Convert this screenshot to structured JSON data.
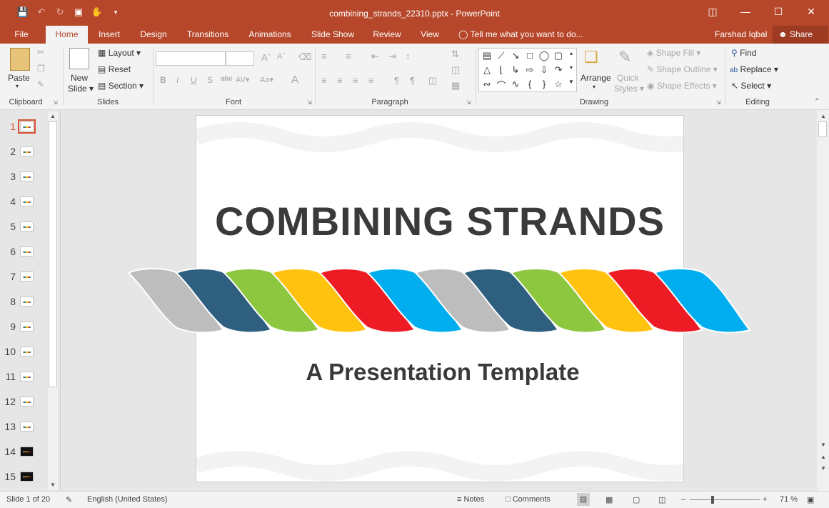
{
  "window": {
    "title": "combining_strands_22310.pptx - PowerPoint"
  },
  "tabs": [
    "File",
    "Home",
    "Insert",
    "Design",
    "Transitions",
    "Animations",
    "Slide Show",
    "Review",
    "View"
  ],
  "active_tab": "Home",
  "tell_me": "Tell me what you want to do...",
  "user_name": "Farshad Iqbal",
  "share_label": "Share",
  "ribbon": {
    "clipboard": {
      "label": "Clipboard",
      "paste": "Paste"
    },
    "slides": {
      "label": "Slides",
      "new_slide_1": "New",
      "new_slide_2": "Slide",
      "layout": "Layout",
      "reset": "Reset",
      "section": "Section"
    },
    "font": {
      "label": "Font"
    },
    "paragraph": {
      "label": "Paragraph"
    },
    "drawing": {
      "label": "Drawing",
      "arrange": "Arrange",
      "quick_styles_1": "Quick",
      "quick_styles_2": "Styles",
      "shape_fill": "Shape Fill",
      "shape_outline": "Shape Outline",
      "shape_effects": "Shape Effects"
    },
    "editing": {
      "label": "Editing",
      "find": "Find",
      "replace": "Replace",
      "select": "Select"
    }
  },
  "slide_numbers": [
    "1",
    "2",
    "3",
    "4",
    "5",
    "6",
    "7",
    "8",
    "9",
    "10",
    "11",
    "12",
    "13",
    "14",
    "15"
  ],
  "selected_slide": 1,
  "slide": {
    "title": "COMBINING STRANDS",
    "subtitle": "A Presentation Template",
    "strand_colors": [
      "#bdbdbd",
      "#2f5f7f",
      "#8dc63f",
      "#ffc20e",
      "#ed1c24",
      "#00aeef",
      "#bdbdbd",
      "#2f5f7f",
      "#8dc63f",
      "#ffc20e",
      "#ed1c24",
      "#00aeef"
    ]
  },
  "status": {
    "slide_info": "Slide 1 of 20",
    "language": "English (United States)",
    "notes": "Notes",
    "comments": "Comments",
    "zoom": "71 %"
  }
}
